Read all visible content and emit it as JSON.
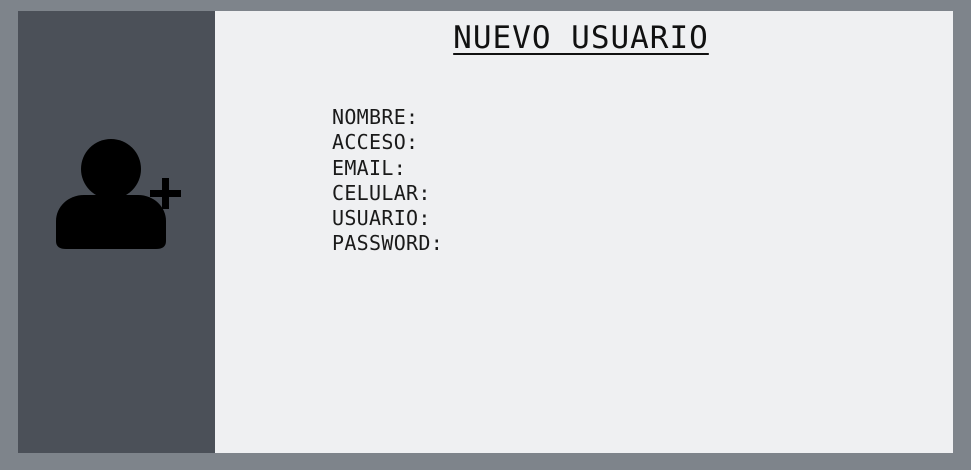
{
  "window": {
    "title": "NUEVO USUARIO"
  },
  "sidebar": {
    "icon": "add-user-icon"
  },
  "form": {
    "fields": [
      {
        "label": "NOMBRE:"
      },
      {
        "label": "ACCESO:"
      },
      {
        "label": "EMAIL:"
      },
      {
        "label": "CELULAR:"
      },
      {
        "label": "USUARIO:"
      },
      {
        "label": "PASSWORD:"
      }
    ]
  },
  "colors": {
    "background": "#7e848b",
    "sidebar": "#4b5058",
    "panel": "#eff0f2",
    "text": "#111111"
  }
}
